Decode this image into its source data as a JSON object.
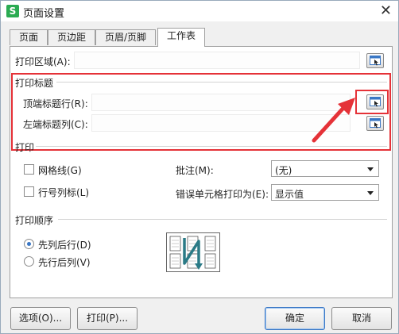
{
  "window": {
    "title": "页面设置",
    "app_icon": "S"
  },
  "tabs": [
    {
      "label": "页面"
    },
    {
      "label": "页边距"
    },
    {
      "label": "页眉/页脚"
    },
    {
      "label": "工作表"
    }
  ],
  "print_area": {
    "label": "打印区域(A):",
    "value": ""
  },
  "print_titles": {
    "section": "打印标题",
    "top_rows_label": "顶端标题行(R):",
    "left_cols_label": "左端标题列(C):"
  },
  "print": {
    "section": "打印",
    "gridlines_label": "网格线(G)",
    "row_col_headers_label": "行号列标(L)",
    "comments_label": "批注(M):",
    "comments_value": "(无)",
    "errors_label": "错误单元格打印为(E):",
    "errors_value": "显示值"
  },
  "order": {
    "section": "打印顺序",
    "down_then_over": "先列后行(D)",
    "over_then_down": "先行后列(V)",
    "selected": "down_then_over"
  },
  "buttons": {
    "options": "选项(O)...",
    "print": "打印(P)...",
    "ok": "确定",
    "cancel": "取消"
  },
  "colors": {
    "highlight": "#e53238",
    "accent": "#3a77c5"
  }
}
